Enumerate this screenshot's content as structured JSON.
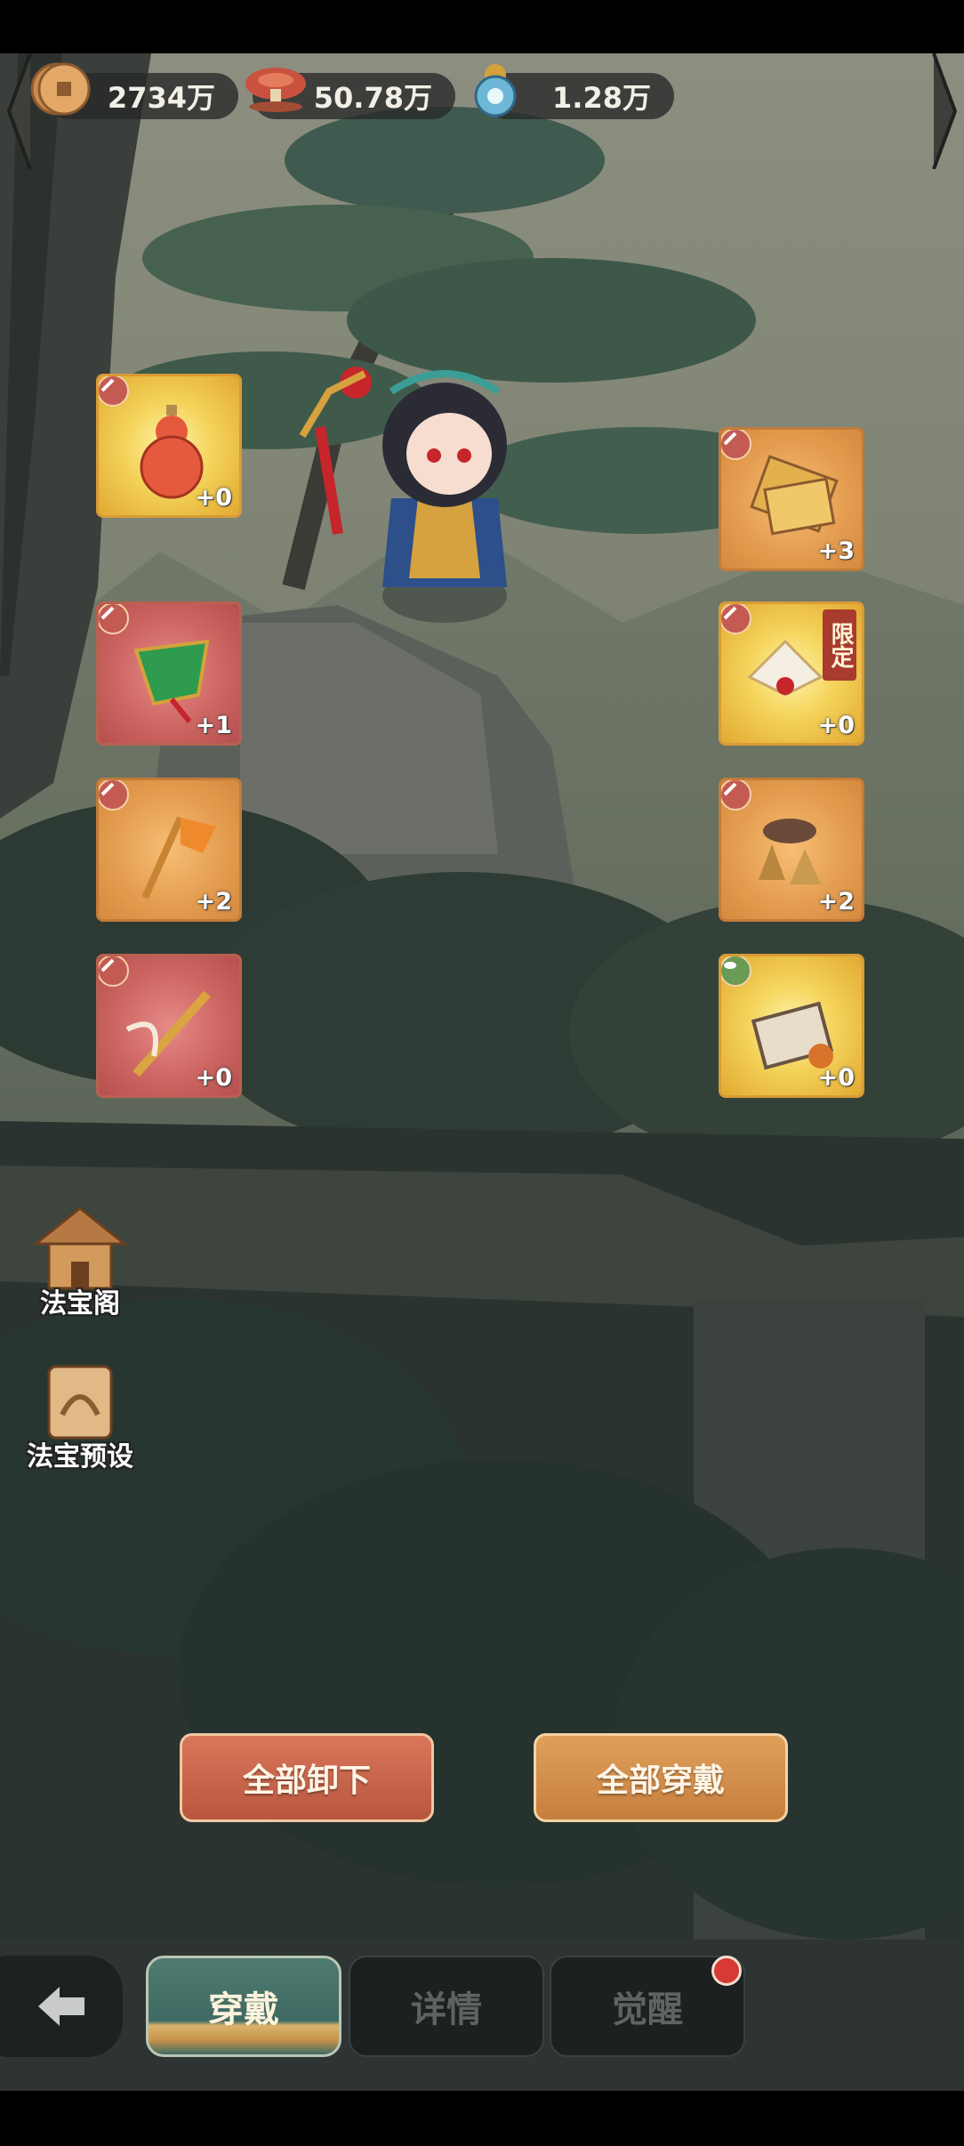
{
  "resources": [
    {
      "icon": "copper-coin-icon",
      "amount": "2734万"
    },
    {
      "icon": "spirit-mushroom-icon",
      "amount": "50.78万"
    },
    {
      "icon": "blue-gourd-icon",
      "amount": "1.28万"
    }
  ],
  "slots": {
    "left": [
      {
        "icon": "red-gourd-icon",
        "level": "+0",
        "rarity": "gold"
      },
      {
        "icon": "green-fan-icon",
        "level": "+1",
        "rarity": "red"
      },
      {
        "icon": "fire-flag-staff-icon",
        "level": "+2",
        "rarity": "orange"
      },
      {
        "icon": "flying-sword-icon",
        "level": "+0",
        "rarity": "red"
      }
    ],
    "right": [
      {
        "icon": "talisman-scrolls-icon",
        "level": "+3",
        "rarity": "orange"
      },
      {
        "icon": "white-feather-fan-icon",
        "level": "+0",
        "rarity": "gold",
        "badge": "限定"
      },
      {
        "icon": "bronze-bells-icon",
        "level": "+2",
        "rarity": "orange"
      },
      {
        "icon": "spell-book-icon",
        "level": "+0",
        "rarity": "gold"
      }
    ]
  },
  "side_buttons": {
    "treasure_pavilion": "法宝阁",
    "treasure_preset": "法宝预设"
  },
  "actions": {
    "unequip_all": "全部卸下",
    "equip_all": "全部穿戴"
  },
  "tabs": [
    {
      "label": "穿戴",
      "active": true
    },
    {
      "label": "详情",
      "active": false
    },
    {
      "label": "觉醒",
      "active": false,
      "notification": true
    }
  ]
}
